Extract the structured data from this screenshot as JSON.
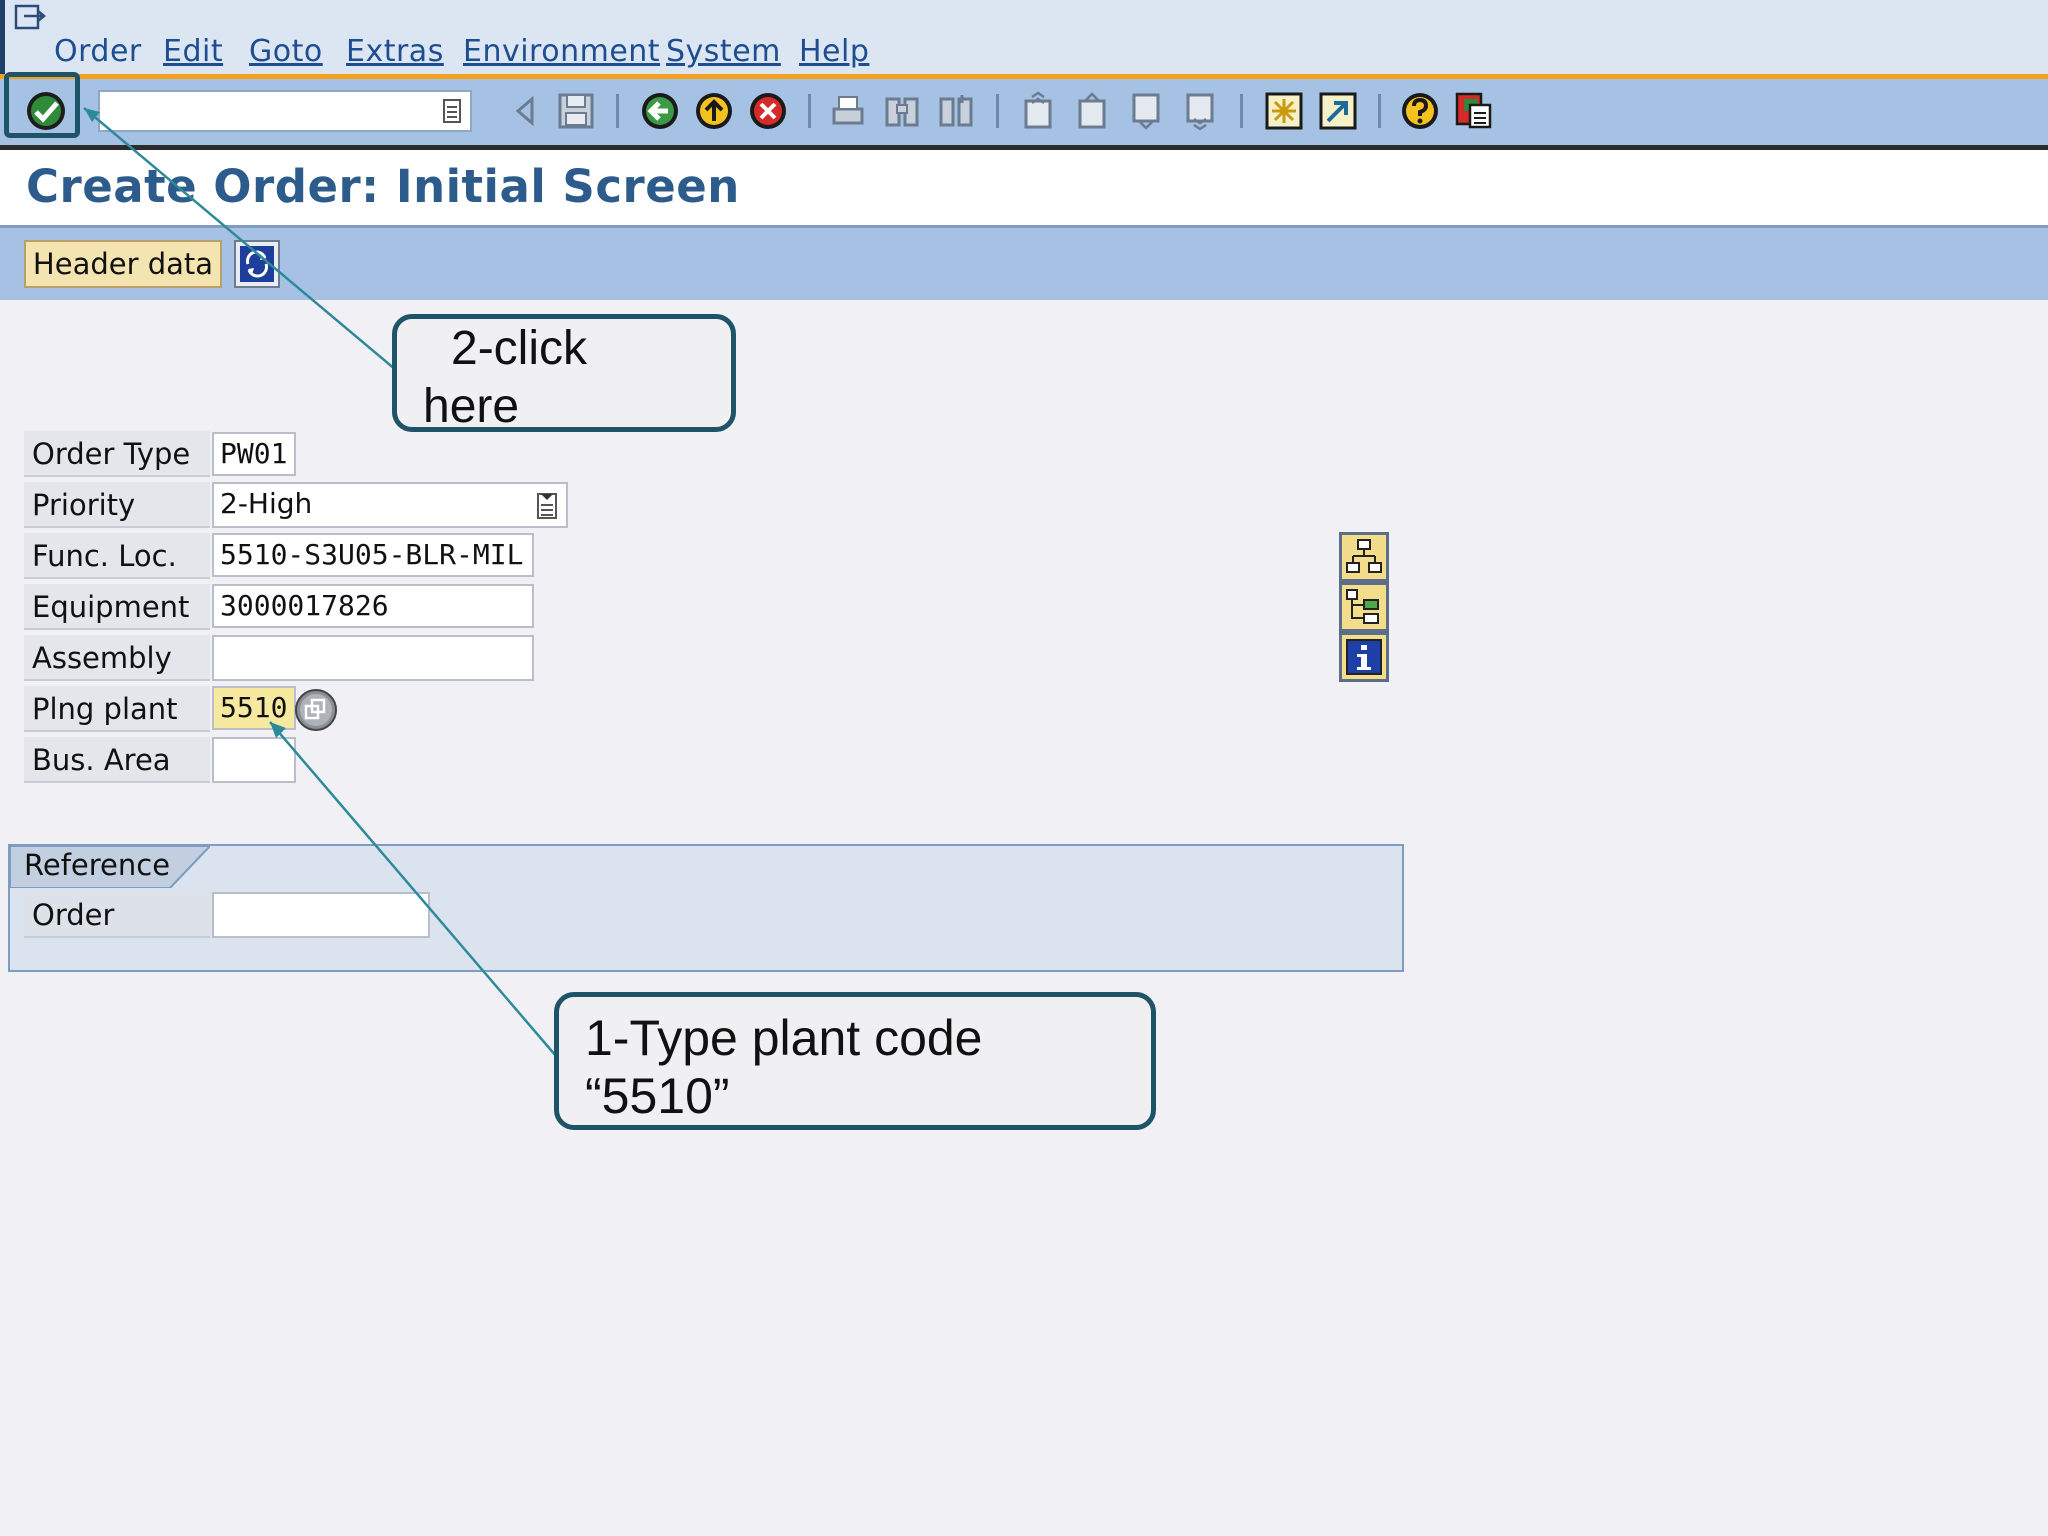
{
  "menu": {
    "items": [
      {
        "label": "Order"
      },
      {
        "label": "Edit"
      },
      {
        "label": "Goto"
      },
      {
        "label": "Extras"
      },
      {
        "label": "Environment"
      },
      {
        "label": "System"
      },
      {
        "label": "Help"
      }
    ]
  },
  "toolbar": {
    "command_field_value": "",
    "icons": [
      "enter-check-icon",
      "back-arrow-icon",
      "save-icon",
      "back-icon",
      "exit-icon",
      "cancel-icon",
      "print-icon",
      "find-icon",
      "find-next-icon",
      "first-page-icon",
      "previous-page-icon",
      "next-page-icon",
      "last-page-icon",
      "create-session-icon",
      "shortcut-icon",
      "help-icon",
      "customize-layout-icon"
    ]
  },
  "title": "Create Order: Initial Screen",
  "app_toolbar": {
    "header_data_label": "Header data"
  },
  "form": {
    "order_type": {
      "label": "Order Type",
      "value": "PW01"
    },
    "priority": {
      "label": "Priority",
      "value": "2-High"
    },
    "func_loc": {
      "label": "Func. Loc.",
      "value": "5510-S3U05-BLR-MIL"
    },
    "equipment": {
      "label": "Equipment",
      "value": "3000017826"
    },
    "assembly": {
      "label": "Assembly",
      "value": ""
    },
    "plng_plant": {
      "label": "Plng plant",
      "value": "5510"
    },
    "bus_area": {
      "label": "Bus. Area",
      "value": ""
    }
  },
  "reference": {
    "title": "Reference",
    "order_label": "Order",
    "order_value": ""
  },
  "callouts": {
    "click": {
      "line1": "2-click",
      "line2": "here"
    },
    "type": {
      "line1": "1-Type plant code",
      "line2": "“5510”"
    }
  },
  "colors": {
    "menubar_bg": "#dce6f3",
    "toolbar_bg": "#a5c1e3",
    "accent_orange": "#f1a11a",
    "title_text": "#2d5b8c",
    "highlight_field": "#f8e9a0",
    "callout_border": "#1f5468"
  }
}
